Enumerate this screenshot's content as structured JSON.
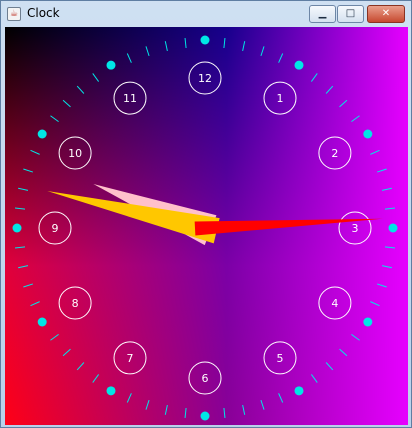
{
  "window": {
    "title": "Clock",
    "icon": "java-cup-icon",
    "controls": {
      "minimize": "minimize-icon",
      "maximize": "maximize-icon",
      "close": "close-icon"
    }
  },
  "clock": {
    "numerals": [
      "12",
      "1",
      "2",
      "3",
      "4",
      "5",
      "6",
      "7",
      "8",
      "9",
      "10",
      "11"
    ],
    "colors": {
      "background_top_left": "#000000",
      "background_top_right": "#0000ff",
      "background_bottom_left": "#ff0000",
      "background_bottom_right": "#ff00ff",
      "ticks": "#00e6e6",
      "hour_dots": "#00e6e6",
      "numeral_ring": "#ffffff",
      "hour_hand": "#ffc0cb",
      "minute_hand": "#ffc700",
      "second_hand": "#ff0000"
    },
    "time_shown": {
      "hour": 9,
      "minute": 47,
      "second": 12
    }
  }
}
